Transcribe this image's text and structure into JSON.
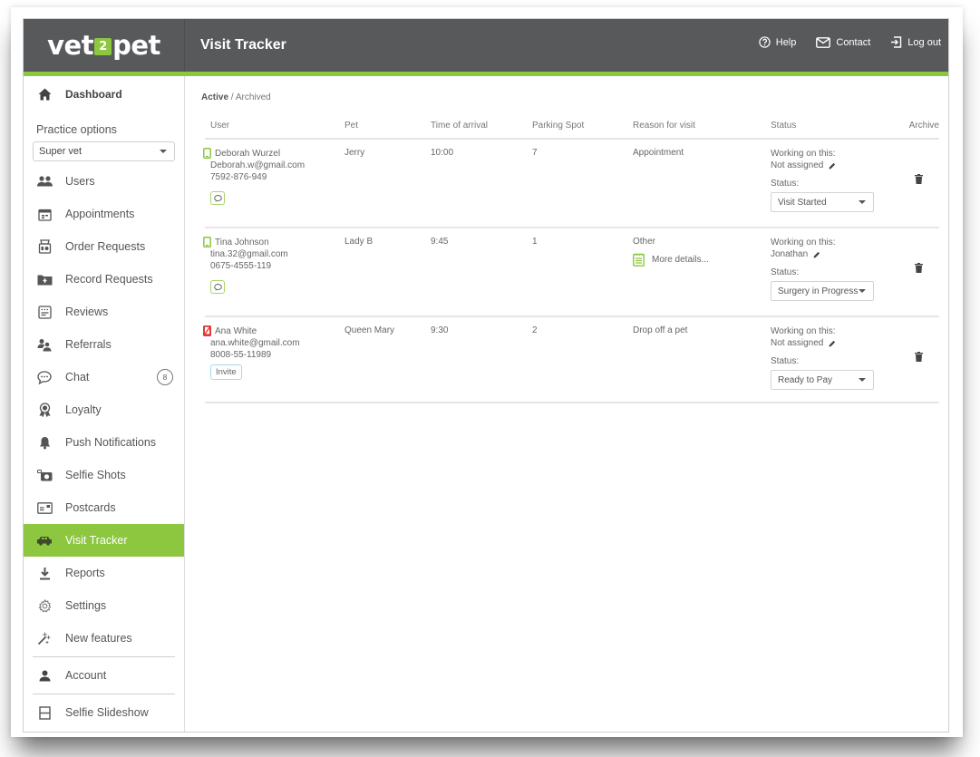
{
  "header": {
    "logo": {
      "left": "vet",
      "middle": "2",
      "right": "pet"
    },
    "title": "Visit Tracker",
    "actions": [
      {
        "label": "Help",
        "icon": "help-circle-icon"
      },
      {
        "label": "Contact",
        "icon": "envelope-icon"
      },
      {
        "label": "Log out",
        "icon": "logout-icon"
      }
    ]
  },
  "colors": {
    "accent": "#8dc63f",
    "header_bg": "#58595b",
    "invite_border": "#a9d7ef",
    "no_app_red": "#e53935"
  },
  "sidebar": {
    "dashboard": "Dashboard",
    "practice_label": "Practice options",
    "practice_selected": "Super vet",
    "items": [
      {
        "label": "Users",
        "icon": "users-icon"
      },
      {
        "label": "Appointments",
        "icon": "calendar-icon"
      },
      {
        "label": "Order Requests",
        "icon": "order-icon"
      },
      {
        "label": "Record Requests",
        "icon": "record-icon"
      },
      {
        "label": "Reviews",
        "icon": "reviews-icon"
      },
      {
        "label": "Referrals",
        "icon": "referrals-icon"
      },
      {
        "label": "Chat",
        "icon": "chat-icon",
        "badge": "8"
      },
      {
        "label": "Loyalty",
        "icon": "award-icon"
      },
      {
        "label": "Push Notifications",
        "icon": "bell-icon"
      },
      {
        "label": "Selfie Shots",
        "icon": "camera-icon"
      },
      {
        "label": "Postcards",
        "icon": "postcard-icon"
      },
      {
        "label": "Visit Tracker",
        "icon": "car-icon",
        "active": true
      },
      {
        "label": "Reports",
        "icon": "download-icon"
      },
      {
        "label": "Settings",
        "icon": "gear-icon"
      },
      {
        "label": "New features",
        "icon": "magic-wand-icon"
      }
    ],
    "account": "Account",
    "slideshow": "Selfie Slideshow"
  },
  "main": {
    "filter": {
      "active": "Active",
      "separator": " / ",
      "archived": "Archived"
    },
    "columns": [
      "User",
      "Pet",
      "Time of arrival",
      "Parking Spot",
      "Reason for visit",
      "Status",
      "Archive"
    ],
    "rows": [
      {
        "name": "Deborah Wurzel",
        "email": "Deborah.w@gmail.com",
        "phone": "7592-876-949",
        "app_installed": true,
        "pet": "Jerry",
        "time": "10:00",
        "spot": "7",
        "reason": "Appointment",
        "more_details": null,
        "working_label": "Working on this:",
        "assignee": "Not assigned",
        "status_label": "Status:",
        "status": "Visit Started"
      },
      {
        "name": "Tina Johnson",
        "email": "tina.32@gmail.com",
        "phone": "0675-4555-119",
        "app_installed": true,
        "pet": "Lady B",
        "time": "9:45",
        "spot": "1",
        "reason": "Other",
        "more_details": "More details...",
        "working_label": "Working on this:",
        "assignee": "Jonathan",
        "status_label": "Status:",
        "status": "Surgery in Progress"
      },
      {
        "name": "Ana White",
        "email": "ana.white@gmail.com",
        "phone": "8008-55-11989",
        "app_installed": false,
        "invite": "Invite",
        "pet": "Queen Mary",
        "time": "9:30",
        "spot": "2",
        "reason": "Drop off a pet",
        "more_details": null,
        "working_label": "Working on this:",
        "assignee": "Not assigned",
        "status_label": "Status:",
        "status": "Ready to Pay"
      }
    ]
  }
}
